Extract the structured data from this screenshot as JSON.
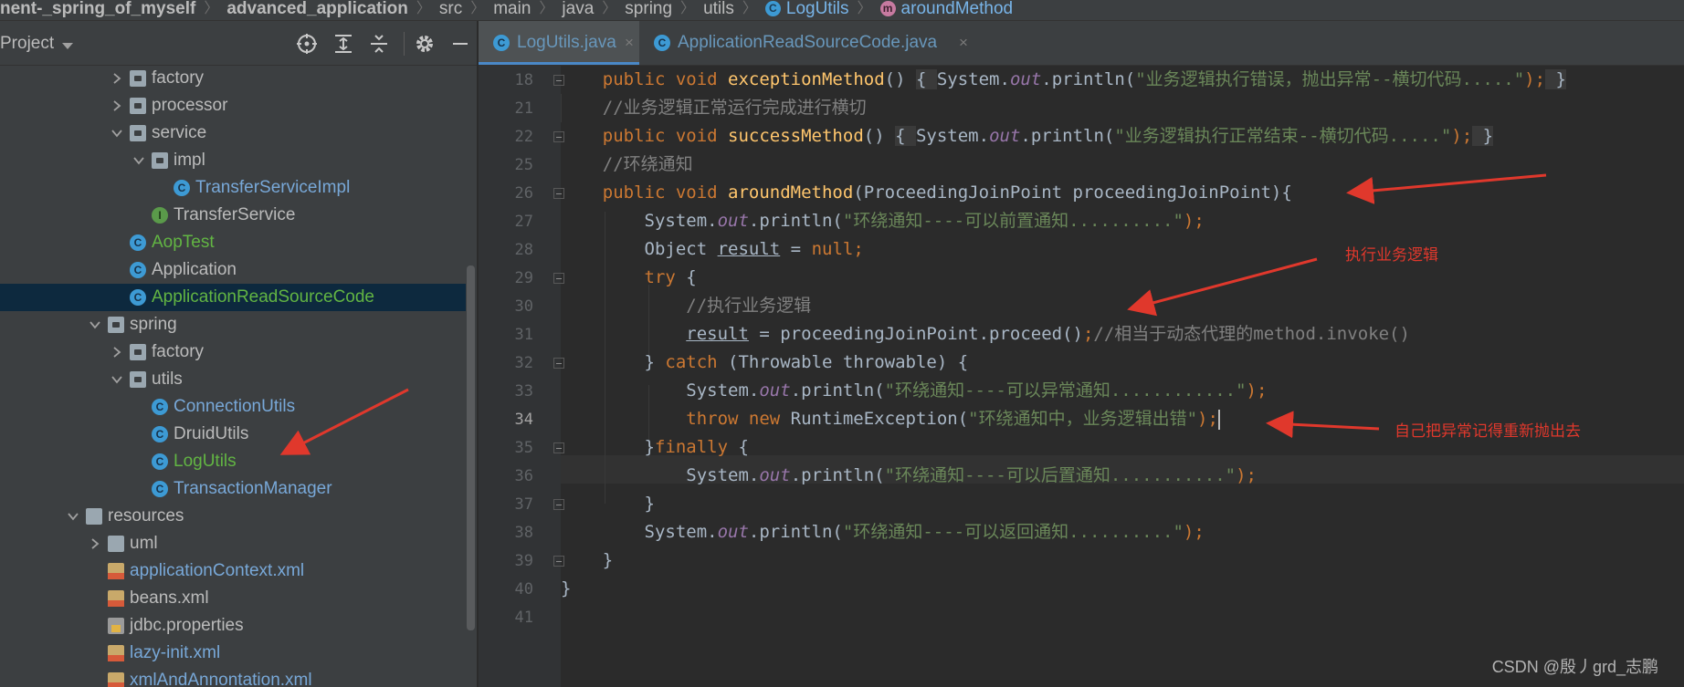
{
  "breadcrumb": {
    "segments": [
      "nent-_spring_of_myself",
      "advanced_application",
      "src",
      "main",
      "java",
      "spring",
      "utils"
    ],
    "class_icon_letter": "C",
    "class_name": "LogUtils",
    "method_icon_letter": "m",
    "method_name": "aroundMethod"
  },
  "project_panel": {
    "title": "Project",
    "toolbar_icons": [
      "locate-icon",
      "expand-all-icon",
      "collapse-all-icon",
      "settings-icon",
      "hide-icon"
    ]
  },
  "tree": [
    {
      "label": "factory",
      "type": "folder",
      "depth": 2,
      "expanded": false
    },
    {
      "label": "processor",
      "type": "folder",
      "depth": 2,
      "expanded": false
    },
    {
      "label": "service",
      "type": "folder",
      "depth": 2,
      "expanded": true
    },
    {
      "label": "impl",
      "type": "folder",
      "depth": 3,
      "expanded": true
    },
    {
      "label": "TransferServiceImpl",
      "type": "class",
      "depth": 4
    },
    {
      "label": "TransferService",
      "type": "interface",
      "depth": 3
    },
    {
      "label": "AopTest",
      "type": "runnable-class",
      "depth": 2
    },
    {
      "label": "Application",
      "type": "runnable-class",
      "depth": 2
    },
    {
      "label": "ApplicationReadSourceCode",
      "type": "runnable-class",
      "depth": 2,
      "selected": true
    },
    {
      "label": "spring",
      "type": "folder",
      "depth": 1,
      "expanded": true
    },
    {
      "label": "factory",
      "type": "folder",
      "depth": 2,
      "expanded": false
    },
    {
      "label": "utils",
      "type": "folder",
      "depth": 2,
      "expanded": true
    },
    {
      "label": "ConnectionUtils",
      "type": "class",
      "depth": 3
    },
    {
      "label": "DruidUtils",
      "type": "class",
      "depth": 3
    },
    {
      "label": "LogUtils",
      "type": "class",
      "depth": 3
    },
    {
      "label": "TransactionManager",
      "type": "class",
      "depth": 3
    },
    {
      "label": "resources",
      "type": "resource-folder",
      "depth": 0,
      "expanded": true
    },
    {
      "label": "uml",
      "type": "folder",
      "depth": 1,
      "expanded": false
    },
    {
      "label": "applicationContext.xml",
      "type": "xml",
      "depth": 1
    },
    {
      "label": "beans.xml",
      "type": "xml",
      "depth": 1
    },
    {
      "label": "jdbc.properties",
      "type": "properties",
      "depth": 1
    },
    {
      "label": "lazy-init.xml",
      "type": "xml",
      "depth": 1
    },
    {
      "label": "xmlAndAnnontation.xml",
      "type": "xml",
      "depth": 1
    }
  ],
  "editor": {
    "tabs": [
      {
        "label": "LogUtils.java",
        "close": "×",
        "active": true
      },
      {
        "label": "ApplicationReadSourceCode.java",
        "close": "×",
        "active": false
      }
    ],
    "current_line": "34",
    "line_numbers": [
      "18",
      "21",
      "22",
      "25",
      "26",
      "27",
      "28",
      "29",
      "30",
      "31",
      "32",
      "33",
      "34",
      "35",
      "36",
      "37",
      "38",
      "39",
      "40",
      "41"
    ],
    "code": {
      "l18": {
        "kw": "public void ",
        "method": "exceptionMethod",
        "a": "() ",
        "b": "{ ",
        "c": "System.",
        "out": "out",
        "d": ".println(",
        "str": "\"业务逻辑执行错误，抛出异常--横切代码.....\"",
        "e": ");",
        "f": " }"
      },
      "l21": {
        "comment": "//业务逻辑正常运行完成进行横切"
      },
      "l22": {
        "kw": "public void ",
        "method": "successMethod",
        "a": "() ",
        "b": "{ ",
        "c": "System.",
        "out": "out",
        "d": ".println(",
        "str": "\"业务逻辑执行正常结束--横切代码.....\"",
        "e": ");",
        "f": " }"
      },
      "l25": {
        "comment": "//环绕通知"
      },
      "l26": {
        "kw": "public void ",
        "method": "aroundMethod",
        "rest": "(ProceedingJoinPoint proceedingJoinPoint){"
      },
      "l27": {
        "a": "System.",
        "out": "out",
        "b": ".println(",
        "str": "\"环绕通知----可以前置通知..........\"",
        "c": ");"
      },
      "l28": {
        "a": "Object ",
        "var": "result",
        "b": " = ",
        "kw": "null;"
      },
      "l29": {
        "kw": "try ",
        "a": "{"
      },
      "l30": {
        "comment": "//执行业务逻辑"
      },
      "l31": {
        "var": "result",
        "a": " = proceedingJoinPoint.proceed()",
        "b": ";",
        "comment": "//相当于动态代理的method.invoke()"
      },
      "l32": {
        "a": "} ",
        "kw": "catch ",
        "b": "(Throwable throwable) {"
      },
      "l33": {
        "a": "System.",
        "out": "out",
        "b": ".println(",
        "str": "\"环绕通知----可以异常通知............\"",
        "c": ");"
      },
      "l34": {
        "kw": "throw new ",
        "a": "RuntimeException(",
        "str": "\"环绕通知中，业务逻辑出错\"",
        "b": ");"
      },
      "l35": {
        "a": "}",
        "kw": "finally ",
        "b": "{"
      },
      "l36": {
        "a": "System.",
        "out": "out",
        "b": ".println(",
        "str": "\"环绕通知----可以后置通知...........\"",
        "c": ");"
      },
      "l37": {
        "a": "}"
      },
      "l38": {
        "a": "System.",
        "out": "out",
        "b": ".println(",
        "str": "\"环绕通知----可以返回通知..........\"",
        "c": ");"
      },
      "l39": {
        "a": "}"
      },
      "l40": {
        "a": "}"
      }
    }
  },
  "annotations": {
    "business_logic": "执行业务逻辑",
    "rethrow": "自己把异常记得重新抛出去",
    "arrow_color": "#e0382c"
  },
  "watermark": "CSDN @殷丿grd_志鹏",
  "colors": {
    "keyword": "#cc7832",
    "method": "#ffc66d",
    "string": "#6a8759",
    "comment": "#808080",
    "static_field": "#9876aa",
    "default_text": "#a9b7c6",
    "selected_row": "#0d293e",
    "runnable_class_label": "#62b543"
  }
}
